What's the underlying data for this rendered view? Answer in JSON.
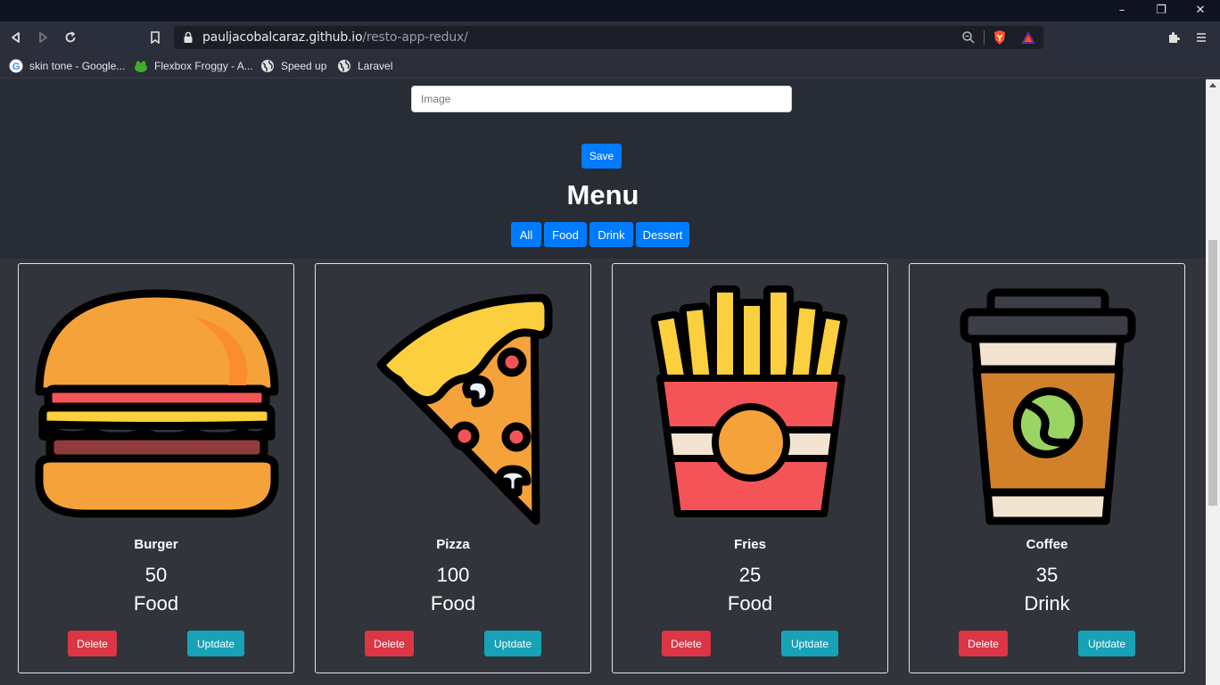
{
  "browser": {
    "url_domain": "pauljacobalcaraz.github.io",
    "url_path": "/resto-app-redux/",
    "bookmarks": [
      {
        "label": "skin tone - Google...",
        "icon": "google-icon"
      },
      {
        "label": "Flexbox Froggy - A...",
        "icon": "frog-icon"
      },
      {
        "label": "Speed up",
        "icon": "globe-icon"
      },
      {
        "label": "Laravel",
        "icon": "globe-icon"
      }
    ]
  },
  "form": {
    "image_placeholder": "Image",
    "save_label": "Save"
  },
  "menu": {
    "title": "Menu",
    "filters": [
      "All",
      "Food",
      "Drink",
      "Dessert"
    ]
  },
  "items": [
    {
      "name": "Burger",
      "price": "50",
      "category": "Food",
      "icon": "burger-icon"
    },
    {
      "name": "Pizza",
      "price": "100",
      "category": "Food",
      "icon": "pizza-icon"
    },
    {
      "name": "Fries",
      "price": "25",
      "category": "Food",
      "icon": "fries-icon"
    },
    {
      "name": "Coffee",
      "price": "35",
      "category": "Drink",
      "icon": "coffee-icon"
    }
  ],
  "actions": {
    "delete_label": "Delete",
    "update_label": "Uptdate"
  },
  "colors": {
    "primary": "#007bff",
    "danger": "#dc3545",
    "info": "#17a2b8",
    "page_bg": "#282c34"
  }
}
